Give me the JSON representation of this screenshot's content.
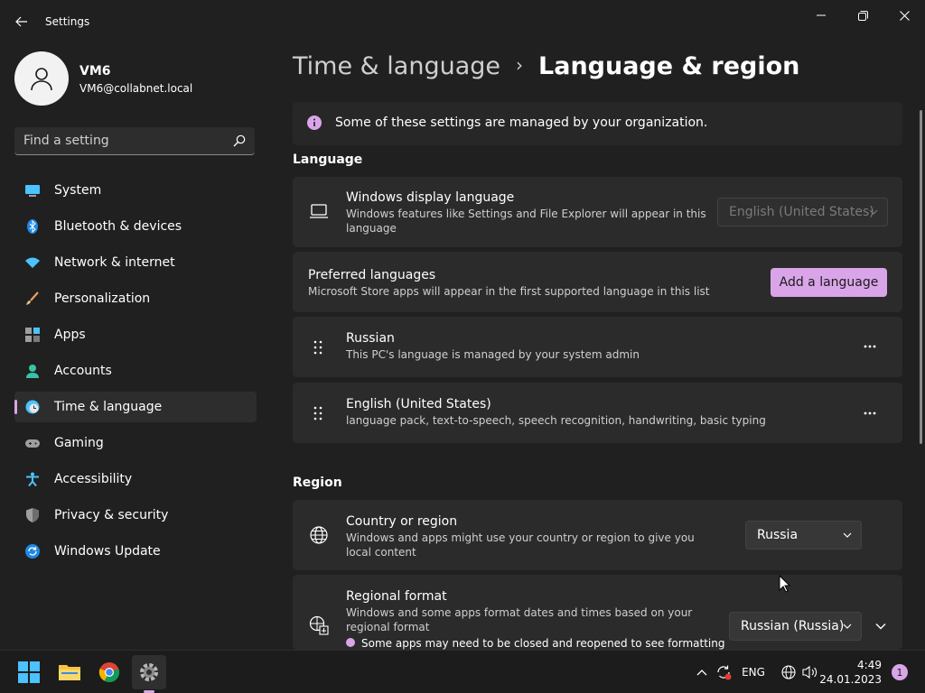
{
  "window": {
    "title": "Settings",
    "icons": {
      "back": "back-arrow-icon",
      "minimize": "minimize-icon",
      "maximize": "maximize-icon",
      "close": "close-icon"
    }
  },
  "user": {
    "name": "VM6",
    "email": "VM6@collabnet.local",
    "avatar_icon": "person-icon"
  },
  "search": {
    "placeholder": "Find a setting",
    "icon": "search-icon"
  },
  "nav": {
    "items": [
      {
        "label": "System",
        "icon": "monitor-icon"
      },
      {
        "label": "Bluetooth & devices",
        "icon": "bluetooth-icon"
      },
      {
        "label": "Network & internet",
        "icon": "wifi-icon"
      },
      {
        "label": "Personalization",
        "icon": "brush-icon"
      },
      {
        "label": "Apps",
        "icon": "apps-icon"
      },
      {
        "label": "Accounts",
        "icon": "account-icon"
      },
      {
        "label": "Time & language",
        "icon": "clock-globe-icon",
        "active": true
      },
      {
        "label": "Gaming",
        "icon": "gamepad-icon"
      },
      {
        "label": "Accessibility",
        "icon": "accessibility-icon"
      },
      {
        "label": "Privacy & security",
        "icon": "shield-icon"
      },
      {
        "label": "Windows Update",
        "icon": "update-icon"
      }
    ]
  },
  "breadcrumb": {
    "parent": "Time & language",
    "separator": "›",
    "current": "Language & region"
  },
  "banner": {
    "text": "Some of these settings are managed by your organization.",
    "icon": "info-icon"
  },
  "language": {
    "title": "Language",
    "display_language": {
      "title": "Windows display language",
      "desc": "Windows features like Settings and File Explorer will appear in this language",
      "value": "English (United States)",
      "icon": "laptop-icon"
    },
    "preferred": {
      "title": "Preferred languages",
      "desc": "Microsoft Store apps will appear in the first supported language in this list",
      "button": "Add a language"
    },
    "languages": [
      {
        "name": "Russian",
        "desc": "This PC's language is managed by your system admin"
      },
      {
        "name": "English (United States)",
        "desc": "language pack, text-to-speech, speech recognition, handwriting, basic typing"
      }
    ]
  },
  "region": {
    "title": "Region",
    "country": {
      "title": "Country or region",
      "desc": "Windows and apps might use your country or region to give you local content",
      "value": "Russia",
      "icon": "globe-icon"
    },
    "format": {
      "title": "Regional format",
      "desc": "Windows and some apps format dates and times based on your regional format",
      "value": "Russian (Russia)",
      "note": "Some apps may need to be closed and reopened to see formatting",
      "icon": "format-icon"
    }
  },
  "taskbar": {
    "apps": [
      "start-icon",
      "file-explorer-icon",
      "chrome-icon",
      "settings-icon"
    ],
    "tray": {
      "lang": "ENG",
      "time": "4:49",
      "date": "24.01.2023",
      "notifications": "1"
    }
  },
  "colors": {
    "accent": "#d9a5e8",
    "background": "#202020",
    "card": "#2b2b2b"
  }
}
